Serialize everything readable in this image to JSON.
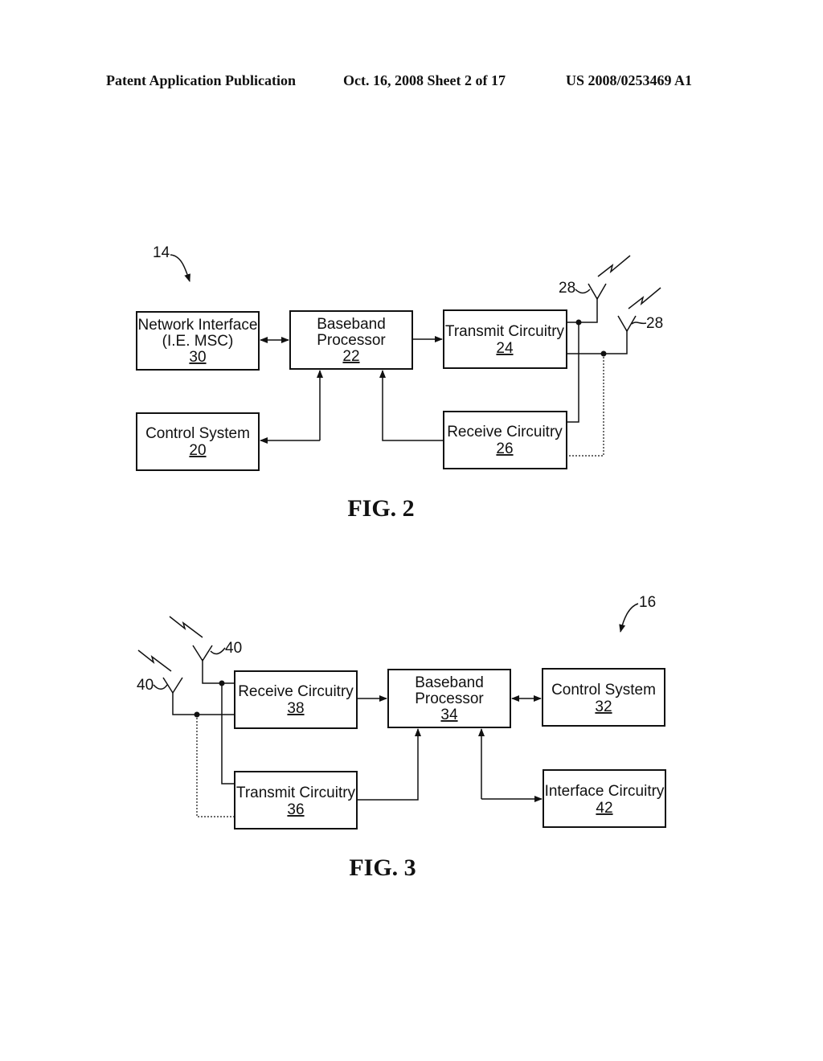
{
  "header": {
    "left": "Patent Application Publication",
    "middle": "Oct. 16, 2008   Sheet 2 of 17",
    "right": "US 2008/0253469 A1"
  },
  "fig2": {
    "caption": "FIG. 2",
    "ref": "14",
    "antenna_ref": "28",
    "blocks": {
      "network_interface": {
        "line1": "Network Interface",
        "line2": "(I.E. MSC)",
        "num": "30"
      },
      "baseband": {
        "line1": "Baseband",
        "line2": "Processor",
        "num": "22"
      },
      "transmit": {
        "line1": "Transmit Circuitry",
        "num": "24"
      },
      "control": {
        "line1": "Control System",
        "num": "20"
      },
      "receive": {
        "line1": "Receive Circuitry",
        "num": "26"
      }
    }
  },
  "fig3": {
    "caption": "FIG. 3",
    "ref": "16",
    "antenna_ref": "40",
    "blocks": {
      "receive": {
        "line1": "Receive Circuitry",
        "num": "38"
      },
      "baseband": {
        "line1": "Baseband",
        "line2": "Processor",
        "num": "34"
      },
      "control": {
        "line1": "Control System",
        "num": "32"
      },
      "transmit": {
        "line1": "Transmit Circuitry",
        "num": "36"
      },
      "interface": {
        "line1": "Interface Circuitry",
        "num": "42"
      }
    }
  }
}
